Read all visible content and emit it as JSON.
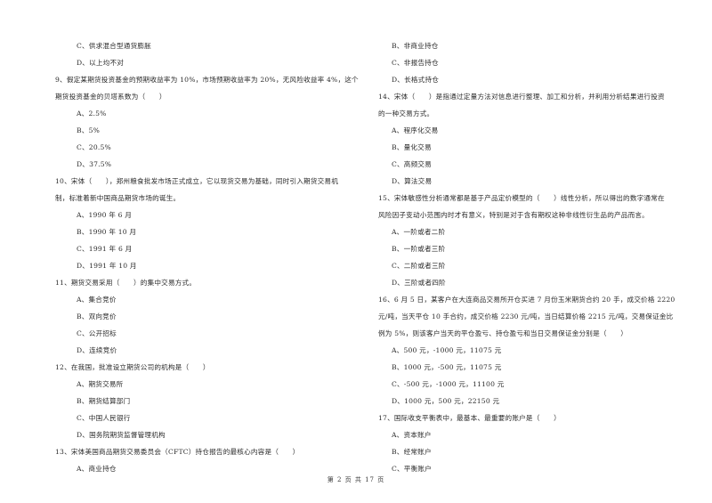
{
  "left_column": [
    {
      "type": "option",
      "text": "C、供求混合型通货膨胀"
    },
    {
      "type": "option",
      "text": "D、以上均不对"
    },
    {
      "type": "question",
      "text": "9、假定某期货投资基金的预期收益率为 10%，市场预期收益率为 20%，无风险收益率 4%，这个"
    },
    {
      "type": "question",
      "text": "期货投资基金的贝塔系数为（　　）"
    },
    {
      "type": "option",
      "text": "A、2.5%"
    },
    {
      "type": "option",
      "text": "B、5%"
    },
    {
      "type": "option",
      "text": "C、20.5%"
    },
    {
      "type": "option",
      "text": "D、37.5%"
    },
    {
      "type": "question",
      "text": "10、宋体（　　），郑州粮食批发市场正式成立，它以现货交易为基础，同时引入期货交易机"
    },
    {
      "type": "question",
      "text": "制，标准着新中国商品期货市场的诞生。"
    },
    {
      "type": "option",
      "text": "A、1990 年 6 月"
    },
    {
      "type": "option",
      "text": "B、1990 年 10 月"
    },
    {
      "type": "option",
      "text": "C、1991 年 6 月"
    },
    {
      "type": "option",
      "text": "D、1991 年 10 月"
    },
    {
      "type": "question",
      "text": "11、期货交易采用（　　）的集中交易方式。"
    },
    {
      "type": "option",
      "text": "A、集合竞价"
    },
    {
      "type": "option",
      "text": "B、双向竞价"
    },
    {
      "type": "option",
      "text": "C、公开招标"
    },
    {
      "type": "option",
      "text": "D、连续竞价"
    },
    {
      "type": "question",
      "text": "12、在我国，批准设立期货公司的机构是（　　）"
    },
    {
      "type": "option",
      "text": "A、期货交易所"
    },
    {
      "type": "option",
      "text": "B、期货结算部门"
    },
    {
      "type": "option",
      "text": "C、中国人民银行"
    },
    {
      "type": "option",
      "text": "D、国务院期货监督管理机构"
    },
    {
      "type": "question",
      "text": "13、宋体美国商品期货交易委员会（CFTC）持仓报告的最核心内容是（　　）"
    },
    {
      "type": "option",
      "text": "A、商业持仓"
    }
  ],
  "right_column": [
    {
      "type": "option",
      "text": "B、非商业持仓"
    },
    {
      "type": "option",
      "text": "C、非报告持仓"
    },
    {
      "type": "option",
      "text": "D、长格式持仓"
    },
    {
      "type": "question",
      "text": "14、宋体（　　）是指通过定量方法对信息进行整理、加工和分析，并利用分析结果进行投资"
    },
    {
      "type": "question",
      "text": "的一种交易方式。"
    },
    {
      "type": "option",
      "text": "A、程序化交易"
    },
    {
      "type": "option",
      "text": "B、量化交易"
    },
    {
      "type": "option",
      "text": "C、高频交易"
    },
    {
      "type": "option",
      "text": "D、算法交易"
    },
    {
      "type": "question",
      "text": "15、宋体敏感性分析通常都是基于产品定价模型的（　　）线性分析，所以得出的数字通常在"
    },
    {
      "type": "question",
      "text": "风险因子变动小范围内时才有意义，特别是对于含有期权这种非线性衍生品的产品而言。"
    },
    {
      "type": "option",
      "text": "A、一阶或者二阶"
    },
    {
      "type": "option",
      "text": "B、一阶或者三阶"
    },
    {
      "type": "option",
      "text": "C、二阶或者三阶"
    },
    {
      "type": "option",
      "text": "D、三阶或者四阶"
    },
    {
      "type": "question",
      "text": "16、6 月 5 日，某客户在大连商品交易所开仓买进 7 月份玉米期货合约 20 手，成交价格 2220"
    },
    {
      "type": "question",
      "text": "元/吨，当天平仓 10 手合约，成交价格 2230 元/吨，当日结算价格 2215 元/吨，交易保证金比"
    },
    {
      "type": "question",
      "text": "例为 5%，则该客户当天的平仓盈亏、持仓盈亏和当日交易保证金分别是（　　）"
    },
    {
      "type": "option",
      "text": "A、500 元，-1000 元，11075 元"
    },
    {
      "type": "option",
      "text": "B、1000 元，-500 元，11075 元"
    },
    {
      "type": "option",
      "text": "C、-500 元，-1000 元，11100 元"
    },
    {
      "type": "option",
      "text": "D、1000 元，500 元，22150 元"
    },
    {
      "type": "question",
      "text": "17、国际收支平衡表中，最基本、最重要的账户是（　　）"
    },
    {
      "type": "option",
      "text": "A、资本账户"
    },
    {
      "type": "option",
      "text": "B、经常账户"
    },
    {
      "type": "option",
      "text": "C、平衡账户"
    }
  ],
  "footer": {
    "page_label": "第 2 页 共 17 页"
  }
}
